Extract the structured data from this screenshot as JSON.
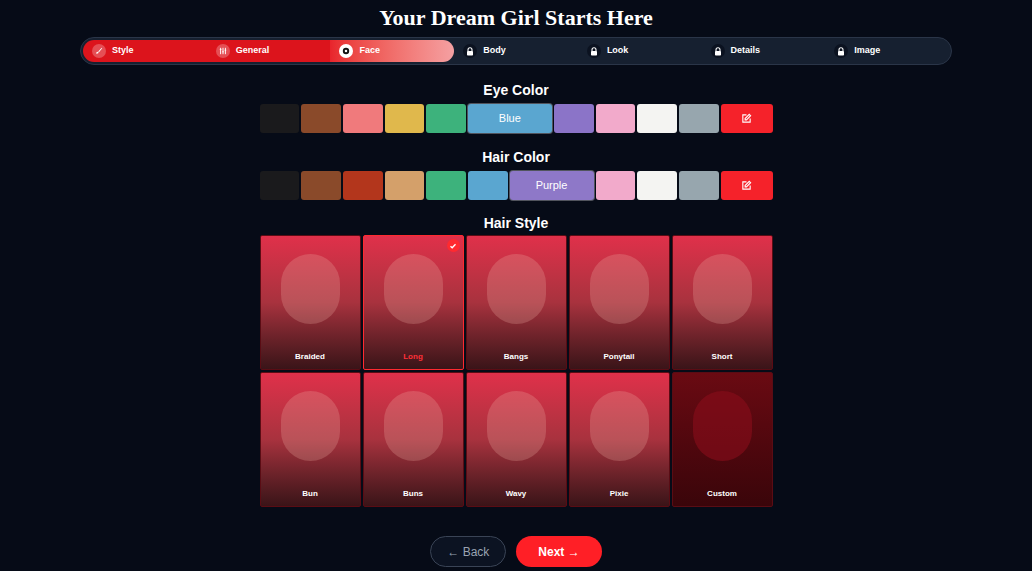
{
  "title": "Your Dream Girl Starts Here",
  "steps": [
    {
      "label": "Style",
      "kind": "done"
    },
    {
      "label": "General",
      "kind": "done"
    },
    {
      "label": "Face",
      "kind": "current"
    },
    {
      "label": "Body",
      "kind": "locked"
    },
    {
      "label": "Look",
      "kind": "locked"
    },
    {
      "label": "Details",
      "kind": "locked"
    },
    {
      "label": "Image",
      "kind": "locked"
    }
  ],
  "eye_color": {
    "heading": "Eye Color",
    "swatches": [
      {
        "color": "#1a1a1c",
        "selected": false
      },
      {
        "color": "#8a4a2a",
        "selected": false
      },
      {
        "color": "#f07a7c",
        "selected": false
      },
      {
        "color": "#e0b84c",
        "selected": false
      },
      {
        "color": "#3db27c",
        "selected": false
      },
      {
        "color": "#5aa6d0",
        "selected": true,
        "label": "Blue"
      },
      {
        "color": "#8b74c8",
        "selected": false
      },
      {
        "color": "#f2aacb",
        "selected": false
      },
      {
        "color": "#f4f4f2",
        "selected": false
      },
      {
        "color": "#97a6ae",
        "selected": false
      }
    ]
  },
  "hair_color": {
    "heading": "Hair Color",
    "swatches": [
      {
        "color": "#1a1a1c",
        "selected": false
      },
      {
        "color": "#8a4a2a",
        "selected": false
      },
      {
        "color": "#b3361c",
        "selected": false
      },
      {
        "color": "#d4a06a",
        "selected": false
      },
      {
        "color": "#3db27c",
        "selected": false
      },
      {
        "color": "#5aa6d0",
        "selected": false
      },
      {
        "color": "#8e78c8",
        "selected": true,
        "label": "Purple"
      },
      {
        "color": "#f2aacb",
        "selected": false
      },
      {
        "color": "#f4f4f2",
        "selected": false
      },
      {
        "color": "#97a6ae",
        "selected": false
      }
    ]
  },
  "hair_style": {
    "heading": "Hair Style",
    "options": [
      {
        "label": "Braided",
        "selected": false,
        "kind": "photo"
      },
      {
        "label": "Long",
        "selected": true,
        "kind": "photo"
      },
      {
        "label": "Bangs",
        "selected": false,
        "kind": "photo"
      },
      {
        "label": "Ponytail",
        "selected": false,
        "kind": "photo"
      },
      {
        "label": "Short",
        "selected": false,
        "kind": "photo"
      },
      {
        "label": "Bun",
        "selected": false,
        "kind": "photo"
      },
      {
        "label": "Buns",
        "selected": false,
        "kind": "photo"
      },
      {
        "label": "Wavy",
        "selected": false,
        "kind": "photo"
      },
      {
        "label": "Pixie",
        "selected": false,
        "kind": "photo"
      },
      {
        "label": "Custom",
        "selected": false,
        "kind": "custom"
      }
    ]
  },
  "buttons": {
    "back": "← Back",
    "next": "Next →"
  }
}
